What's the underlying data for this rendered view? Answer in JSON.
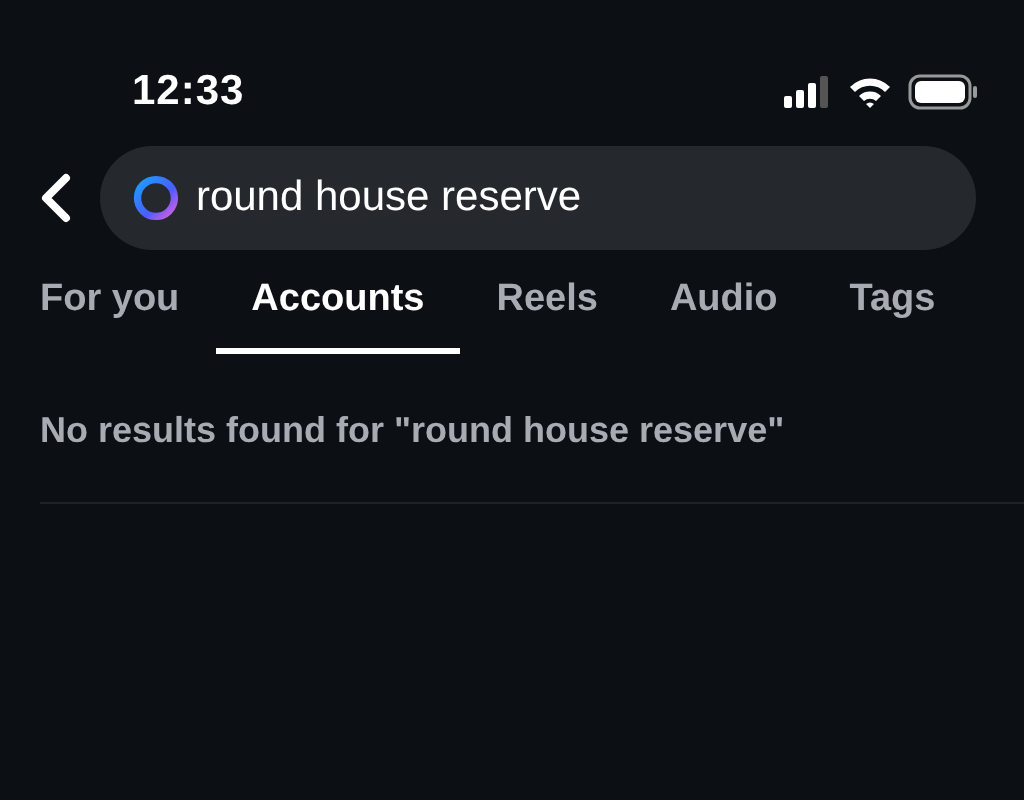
{
  "status_bar": {
    "time": "12:33"
  },
  "search": {
    "value": "round house reserve"
  },
  "tabs": [
    {
      "label": "For you",
      "selected": false
    },
    {
      "label": "Accounts",
      "selected": true
    },
    {
      "label": "Reels",
      "selected": false
    },
    {
      "label": "Audio",
      "selected": false
    },
    {
      "label": "Tags",
      "selected": false
    }
  ],
  "message": "No results found for \"round house reserve\""
}
